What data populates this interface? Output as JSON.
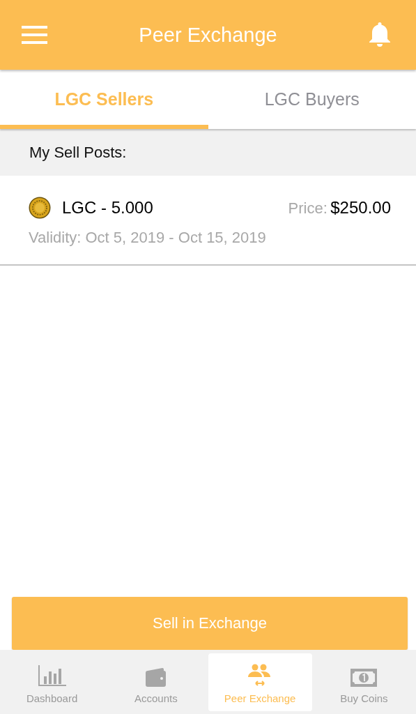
{
  "header": {
    "title": "Peer Exchange"
  },
  "tabs": [
    {
      "label": "LGC Sellers",
      "selected": true
    },
    {
      "label": "LGC Buyers",
      "selected": false
    }
  ],
  "section": {
    "title": "My Sell Posts:"
  },
  "posts": [
    {
      "amount": "LGC - 5.000",
      "price_label": "Price:",
      "price": "$250.00",
      "validity": "Validity: Oct 5, 2019 - Oct 15, 2019"
    }
  ],
  "action_button": "Sell in Exchange",
  "nav": [
    {
      "kind": "chart",
      "label": "Dashboard",
      "selected": false
    },
    {
      "kind": "wallet",
      "label": "Accounts",
      "selected": false
    },
    {
      "kind": "people",
      "label": "Peer Exchange",
      "selected": true
    },
    {
      "kind": "bill",
      "label": "Buy Coins",
      "selected": false
    }
  ]
}
